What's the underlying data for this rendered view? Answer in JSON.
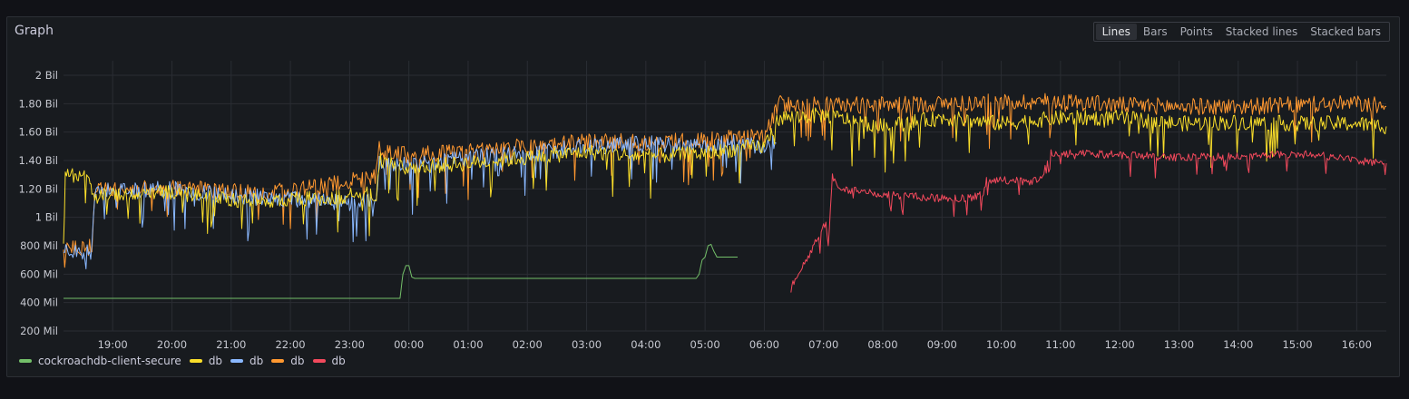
{
  "panel": {
    "title": "Graph",
    "modes": [
      "Lines",
      "Bars",
      "Points",
      "Stacked lines",
      "Stacked bars"
    ],
    "active_mode": "Lines"
  },
  "chart_data": {
    "type": "line",
    "title": "Graph",
    "xlabel": "",
    "ylabel": "",
    "x_unit": "hours since 18:00 (x axis spans ~18:10 to ~16:30 next day)",
    "xlim": [
      0.17,
      22.5
    ],
    "ylim": [
      200,
      2000
    ],
    "y_unit": "Mil",
    "yticks": [
      {
        "value": 200,
        "label": "200 Mil"
      },
      {
        "value": 400,
        "label": "400 Mil"
      },
      {
        "value": 600,
        "label": "600 Mil"
      },
      {
        "value": 800,
        "label": "800 Mil"
      },
      {
        "value": 1000,
        "label": "1 Bil"
      },
      {
        "value": 1200,
        "label": "1.20 Bil"
      },
      {
        "value": 1400,
        "label": "1.40 Bil"
      },
      {
        "value": 1600,
        "label": "1.60 Bil"
      },
      {
        "value": 1800,
        "label": "1.80 Bil"
      },
      {
        "value": 2000,
        "label": "2 Bil"
      }
    ],
    "xticks": [
      {
        "value": 1,
        "label": "19:00"
      },
      {
        "value": 2,
        "label": "20:00"
      },
      {
        "value": 3,
        "label": "21:00"
      },
      {
        "value": 4,
        "label": "22:00"
      },
      {
        "value": 5,
        "label": "23:00"
      },
      {
        "value": 6,
        "label": "00:00"
      },
      {
        "value": 7,
        "label": "01:00"
      },
      {
        "value": 8,
        "label": "02:00"
      },
      {
        "value": 9,
        "label": "03:00"
      },
      {
        "value": 10,
        "label": "04:00"
      },
      {
        "value": 11,
        "label": "05:00"
      },
      {
        "value": 12,
        "label": "06:00"
      },
      {
        "value": 13,
        "label": "07:00"
      },
      {
        "value": 14,
        "label": "08:00"
      },
      {
        "value": 15,
        "label": "09:00"
      },
      {
        "value": 16,
        "label": "10:00"
      },
      {
        "value": 17,
        "label": "11:00"
      },
      {
        "value": 18,
        "label": "12:00"
      },
      {
        "value": 19,
        "label": "13:00"
      },
      {
        "value": 20,
        "label": "14:00"
      },
      {
        "value": 21,
        "label": "15:00"
      },
      {
        "value": 22,
        "label": "16:00"
      }
    ],
    "grid": true,
    "legend_position": "bottom-left",
    "series": [
      {
        "name": "cockroachdb-client-secure",
        "color": "#73bf69",
        "noise": 2,
        "points": [
          [
            0.17,
            430
          ],
          [
            5.85,
            430
          ],
          [
            5.9,
            600
          ],
          [
            5.95,
            660
          ],
          [
            6.0,
            660
          ],
          [
            6.05,
            580
          ],
          [
            6.1,
            570
          ],
          [
            10.85,
            570
          ],
          [
            10.9,
            600
          ],
          [
            10.95,
            700
          ],
          [
            11.0,
            720
          ],
          [
            11.05,
            800
          ],
          [
            11.1,
            810
          ],
          [
            11.15,
            760
          ],
          [
            11.2,
            720
          ],
          [
            11.55,
            720
          ]
        ]
      },
      {
        "name": "db",
        "color": "#fade2a",
        "noise": 55,
        "points": [
          [
            0.17,
            800
          ],
          [
            0.2,
            1300
          ],
          [
            0.6,
            1300
          ],
          [
            0.65,
            1200
          ],
          [
            0.7,
            1150
          ],
          [
            2.0,
            1180
          ],
          [
            3.0,
            1120
          ],
          [
            4.0,
            1120
          ],
          [
            5.0,
            1150
          ],
          [
            5.45,
            1170
          ],
          [
            5.5,
            1400
          ],
          [
            6.0,
            1350
          ],
          [
            7.0,
            1380
          ],
          [
            8.0,
            1420
          ],
          [
            9.0,
            1460
          ],
          [
            10.0,
            1430
          ],
          [
            11.0,
            1450
          ],
          [
            11.5,
            1480
          ],
          [
            12.0,
            1500
          ],
          [
            12.25,
            1700
          ],
          [
            13.0,
            1720
          ],
          [
            14.0,
            1640
          ],
          [
            15.0,
            1700
          ],
          [
            16.0,
            1660
          ],
          [
            17.0,
            1700
          ],
          [
            18.0,
            1700
          ],
          [
            19.0,
            1660
          ],
          [
            20.0,
            1670
          ],
          [
            21.0,
            1660
          ],
          [
            22.0,
            1660
          ],
          [
            22.5,
            1640
          ]
        ]
      },
      {
        "name": "db",
        "color": "#8ab8ff",
        "noise": 60,
        "points": [
          [
            0.17,
            750
          ],
          [
            0.65,
            760
          ],
          [
            0.7,
            1180
          ],
          [
            2.0,
            1200
          ],
          [
            3.0,
            1150
          ],
          [
            4.0,
            1130
          ],
          [
            5.0,
            1100
          ],
          [
            5.45,
            1140
          ],
          [
            5.5,
            1380
          ],
          [
            6.0,
            1360
          ],
          [
            7.0,
            1420
          ],
          [
            8.0,
            1450
          ],
          [
            9.0,
            1500
          ],
          [
            10.0,
            1520
          ],
          [
            11.0,
            1500
          ],
          [
            11.5,
            1530
          ],
          [
            12.0,
            1500
          ],
          [
            12.2,
            1520
          ]
        ]
      },
      {
        "name": "db",
        "color": "#ff9830",
        "noise": 60,
        "points": [
          [
            0.17,
            780
          ],
          [
            0.65,
            790
          ],
          [
            0.7,
            1190
          ],
          [
            2.0,
            1210
          ],
          [
            3.0,
            1180
          ],
          [
            4.0,
            1180
          ],
          [
            5.0,
            1260
          ],
          [
            5.45,
            1290
          ],
          [
            5.5,
            1480
          ],
          [
            6.0,
            1440
          ],
          [
            7.0,
            1460
          ],
          [
            8.0,
            1500
          ],
          [
            9.0,
            1530
          ],
          [
            10.0,
            1530
          ],
          [
            11.0,
            1540
          ],
          [
            11.5,
            1560
          ],
          [
            12.0,
            1560
          ],
          [
            12.25,
            1800
          ],
          [
            13.0,
            1790
          ],
          [
            14.0,
            1790
          ],
          [
            15.0,
            1800
          ],
          [
            16.0,
            1810
          ],
          [
            17.0,
            1820
          ],
          [
            18.0,
            1790
          ],
          [
            19.0,
            1780
          ],
          [
            20.0,
            1780
          ],
          [
            21.0,
            1790
          ],
          [
            22.0,
            1800
          ],
          [
            22.5,
            1780
          ]
        ]
      },
      {
        "name": "db",
        "color": "#f2495c",
        "noise": 28,
        "points": [
          [
            12.45,
            480
          ],
          [
            12.5,
            550
          ],
          [
            12.7,
            700
          ],
          [
            12.8,
            760
          ],
          [
            13.0,
            950
          ],
          [
            13.1,
            950
          ],
          [
            13.15,
            1280
          ],
          [
            13.3,
            1200
          ],
          [
            14.0,
            1160
          ],
          [
            14.5,
            1150
          ],
          [
            15.0,
            1130
          ],
          [
            15.5,
            1140
          ],
          [
            15.7,
            1170
          ],
          [
            15.75,
            1260
          ],
          [
            16.0,
            1260
          ],
          [
            16.5,
            1250
          ],
          [
            16.7,
            1290
          ],
          [
            16.8,
            1450
          ],
          [
            17.0,
            1450
          ],
          [
            18.0,
            1440
          ],
          [
            19.0,
            1420
          ],
          [
            20.0,
            1430
          ],
          [
            21.0,
            1450
          ],
          [
            21.7,
            1420
          ],
          [
            22.0,
            1400
          ],
          [
            22.5,
            1380
          ]
        ]
      }
    ]
  }
}
